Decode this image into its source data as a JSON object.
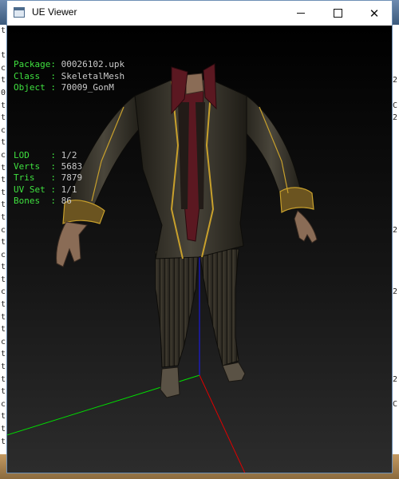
{
  "window": {
    "title": "UE Viewer",
    "controls": {
      "minimize": "minimize",
      "maximize": "maximize",
      "close": "close"
    }
  },
  "info": {
    "group1": [
      {
        "key": "Package",
        "sep": ": ",
        "value": "00026102.upk"
      },
      {
        "key": "Class  ",
        "sep": ": ",
        "value": "SkeletalMesh"
      },
      {
        "key": "Object ",
        "sep": ": ",
        "value": "70009_GonM"
      }
    ],
    "group2": [
      {
        "key": "LOD    ",
        "sep": ": ",
        "value": "1/2"
      },
      {
        "key": "Verts  ",
        "sep": ": ",
        "value": "5683"
      },
      {
        "key": "Tris   ",
        "sep": ": ",
        "value": "7879"
      },
      {
        "key": "UV Set ",
        "sep": ": ",
        "value": "1/1"
      },
      {
        "key": "Bones  ",
        "sep": ": ",
        "value": "86"
      }
    ]
  },
  "axes": {
    "x_color": "#00e000",
    "y_color": "#e00000",
    "z_color": "#1a1aff"
  },
  "background_console": {
    "left_chars": [
      "t",
      "",
      "t",
      "c",
      "t",
      "0",
      "t",
      "t",
      "c",
      "t",
      "c",
      "t",
      "t",
      "t",
      "t",
      "t",
      "c",
      "t",
      "c",
      "t",
      "t",
      "c",
      "t",
      "t",
      "t",
      "c",
      "t",
      "t",
      "t",
      "t",
      "c",
      "t",
      "t",
      "t"
    ],
    "right_chars": [
      "",
      "",
      "",
      "",
      "2",
      "",
      "C",
      "2",
      "",
      "",
      "",
      "",
      "",
      "",
      "",
      "",
      "2",
      "",
      "",
      "",
      "",
      "2",
      "",
      "",
      "",
      "",
      "",
      "",
      "2",
      "",
      "C"
    ]
  }
}
